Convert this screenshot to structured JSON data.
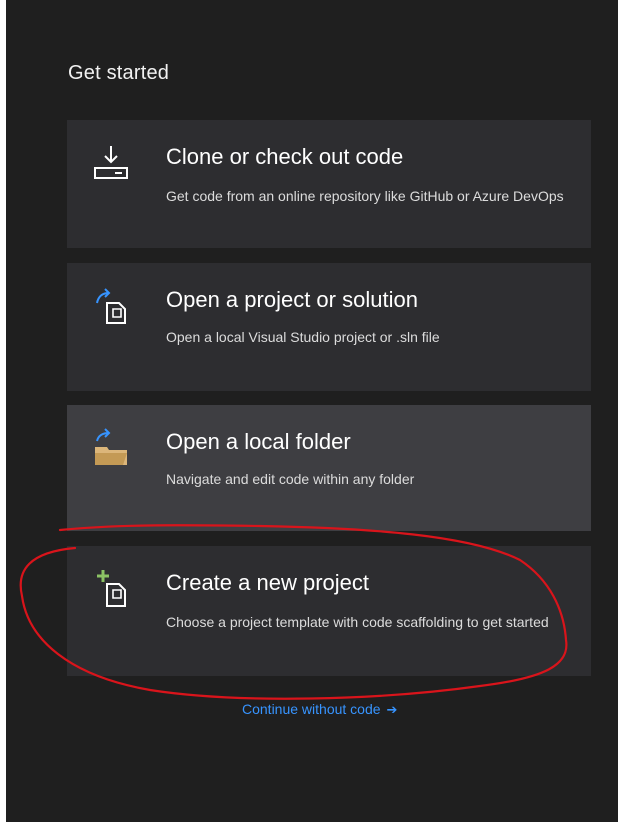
{
  "heading": "Get started",
  "cards": [
    {
      "title": "Clone or check out code",
      "desc": "Get code from an online repository like GitHub or Azure DevOps",
      "icon": "download-drive-icon"
    },
    {
      "title": "Open a project or solution",
      "desc": "Open a local Visual Studio project or .sln file",
      "icon": "open-project-icon"
    },
    {
      "title": "Open a local folder",
      "desc": "Navigate and edit code within any folder",
      "icon": "open-folder-icon"
    },
    {
      "title": "Create a new project",
      "desc": "Choose a project template with code scaffolding to get started",
      "icon": "new-project-icon"
    }
  ],
  "continue_label": "Continue without code",
  "continue_arrow": "➔",
  "colors": {
    "panel": "#1f1f1f",
    "card": "#2d2d30",
    "card_hover": "#3e3e42",
    "link": "#3794ff",
    "annotation": "#d9141b",
    "folder": "#dcb67a",
    "plus": "#8cc265"
  }
}
